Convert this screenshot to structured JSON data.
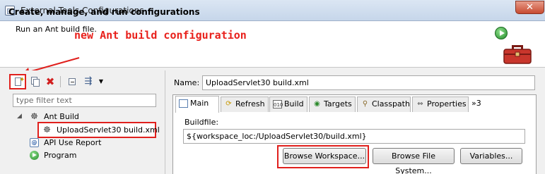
{
  "window": {
    "title": "External Tools Configurations",
    "close_glyph": "✕"
  },
  "header": {
    "title": "Create, manage, and run configurations",
    "description": "Run an Ant build file.",
    "annotation": "new Ant build configuration"
  },
  "left_panel": {
    "filter_placeholder": "type filter text",
    "tree": [
      {
        "label": "Ant Build",
        "icon": "ant-icon",
        "expanded": true
      },
      {
        "label": "UploadServlet30 build.xml",
        "icon": "ant-icon",
        "selected": true
      },
      {
        "label": "API Use Report",
        "icon": "api-report-icon"
      },
      {
        "label": "Program",
        "icon": "program-icon"
      }
    ]
  },
  "right_panel": {
    "name_label": "Name:",
    "name_value": "UploadServlet30 build.xml",
    "tabs": [
      {
        "label": "Main",
        "active": true
      },
      {
        "label": "Refresh"
      },
      {
        "label": "Build"
      },
      {
        "label": "Targets"
      },
      {
        "label": "Classpath"
      },
      {
        "label": "Properties"
      }
    ],
    "tab_overflow": "»3",
    "buildfile_label": "Buildfile:",
    "buildfile_value": "${workspace_loc:/UploadServlet30/build.xml}",
    "buttons": {
      "browse_workspace": "Browse Workspace...",
      "browse_file_system": "Browse File System...",
      "variables": "Variables..."
    }
  },
  "colors": {
    "annotation": "#e8201b",
    "title_bar": "#c6d6ea"
  }
}
